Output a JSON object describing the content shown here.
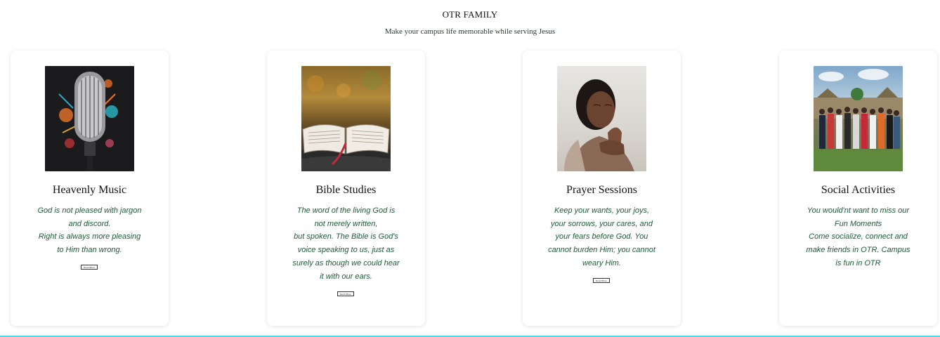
{
  "header": {
    "title": "OTR FAMILY",
    "subtitle": "Make your campus life memorable while serving Jesus"
  },
  "cards": [
    {
      "title": "Heavenly Music",
      "text": "God is not pleased with jargon\nand discord.\nRight is always more pleasing\nto Him than wrong.",
      "button": "Read More",
      "image_icon": "microphone-icon"
    },
    {
      "title": "Bible Studies",
      "text": "The word of the living God is\nnot merely written,\nbut spoken. The Bible is God's\nvoice speaking to us, just as\nsurely as though we could hear\nit with our ears.",
      "button": "Read More",
      "image_icon": "open-bible-icon"
    },
    {
      "title": "Prayer Sessions",
      "text": "Keep your wants, your joys,\nyour sorrows, your cares, and\nyour fears before God. You\ncannot burden Him; you cannot\nweary Him.",
      "button": "Read More",
      "image_icon": "praying-person-icon"
    },
    {
      "title": "Social Activities",
      "text": "You would'nt want to miss our\nFun Moments\nCome socialize, connect and\nmake friends in OTR. Campus\nis fun in OTR",
      "image_icon": "group-photo-icon"
    }
  ],
  "colors": {
    "accent_text": "#1e5b37",
    "bottom_line": "#4dd9e6"
  }
}
